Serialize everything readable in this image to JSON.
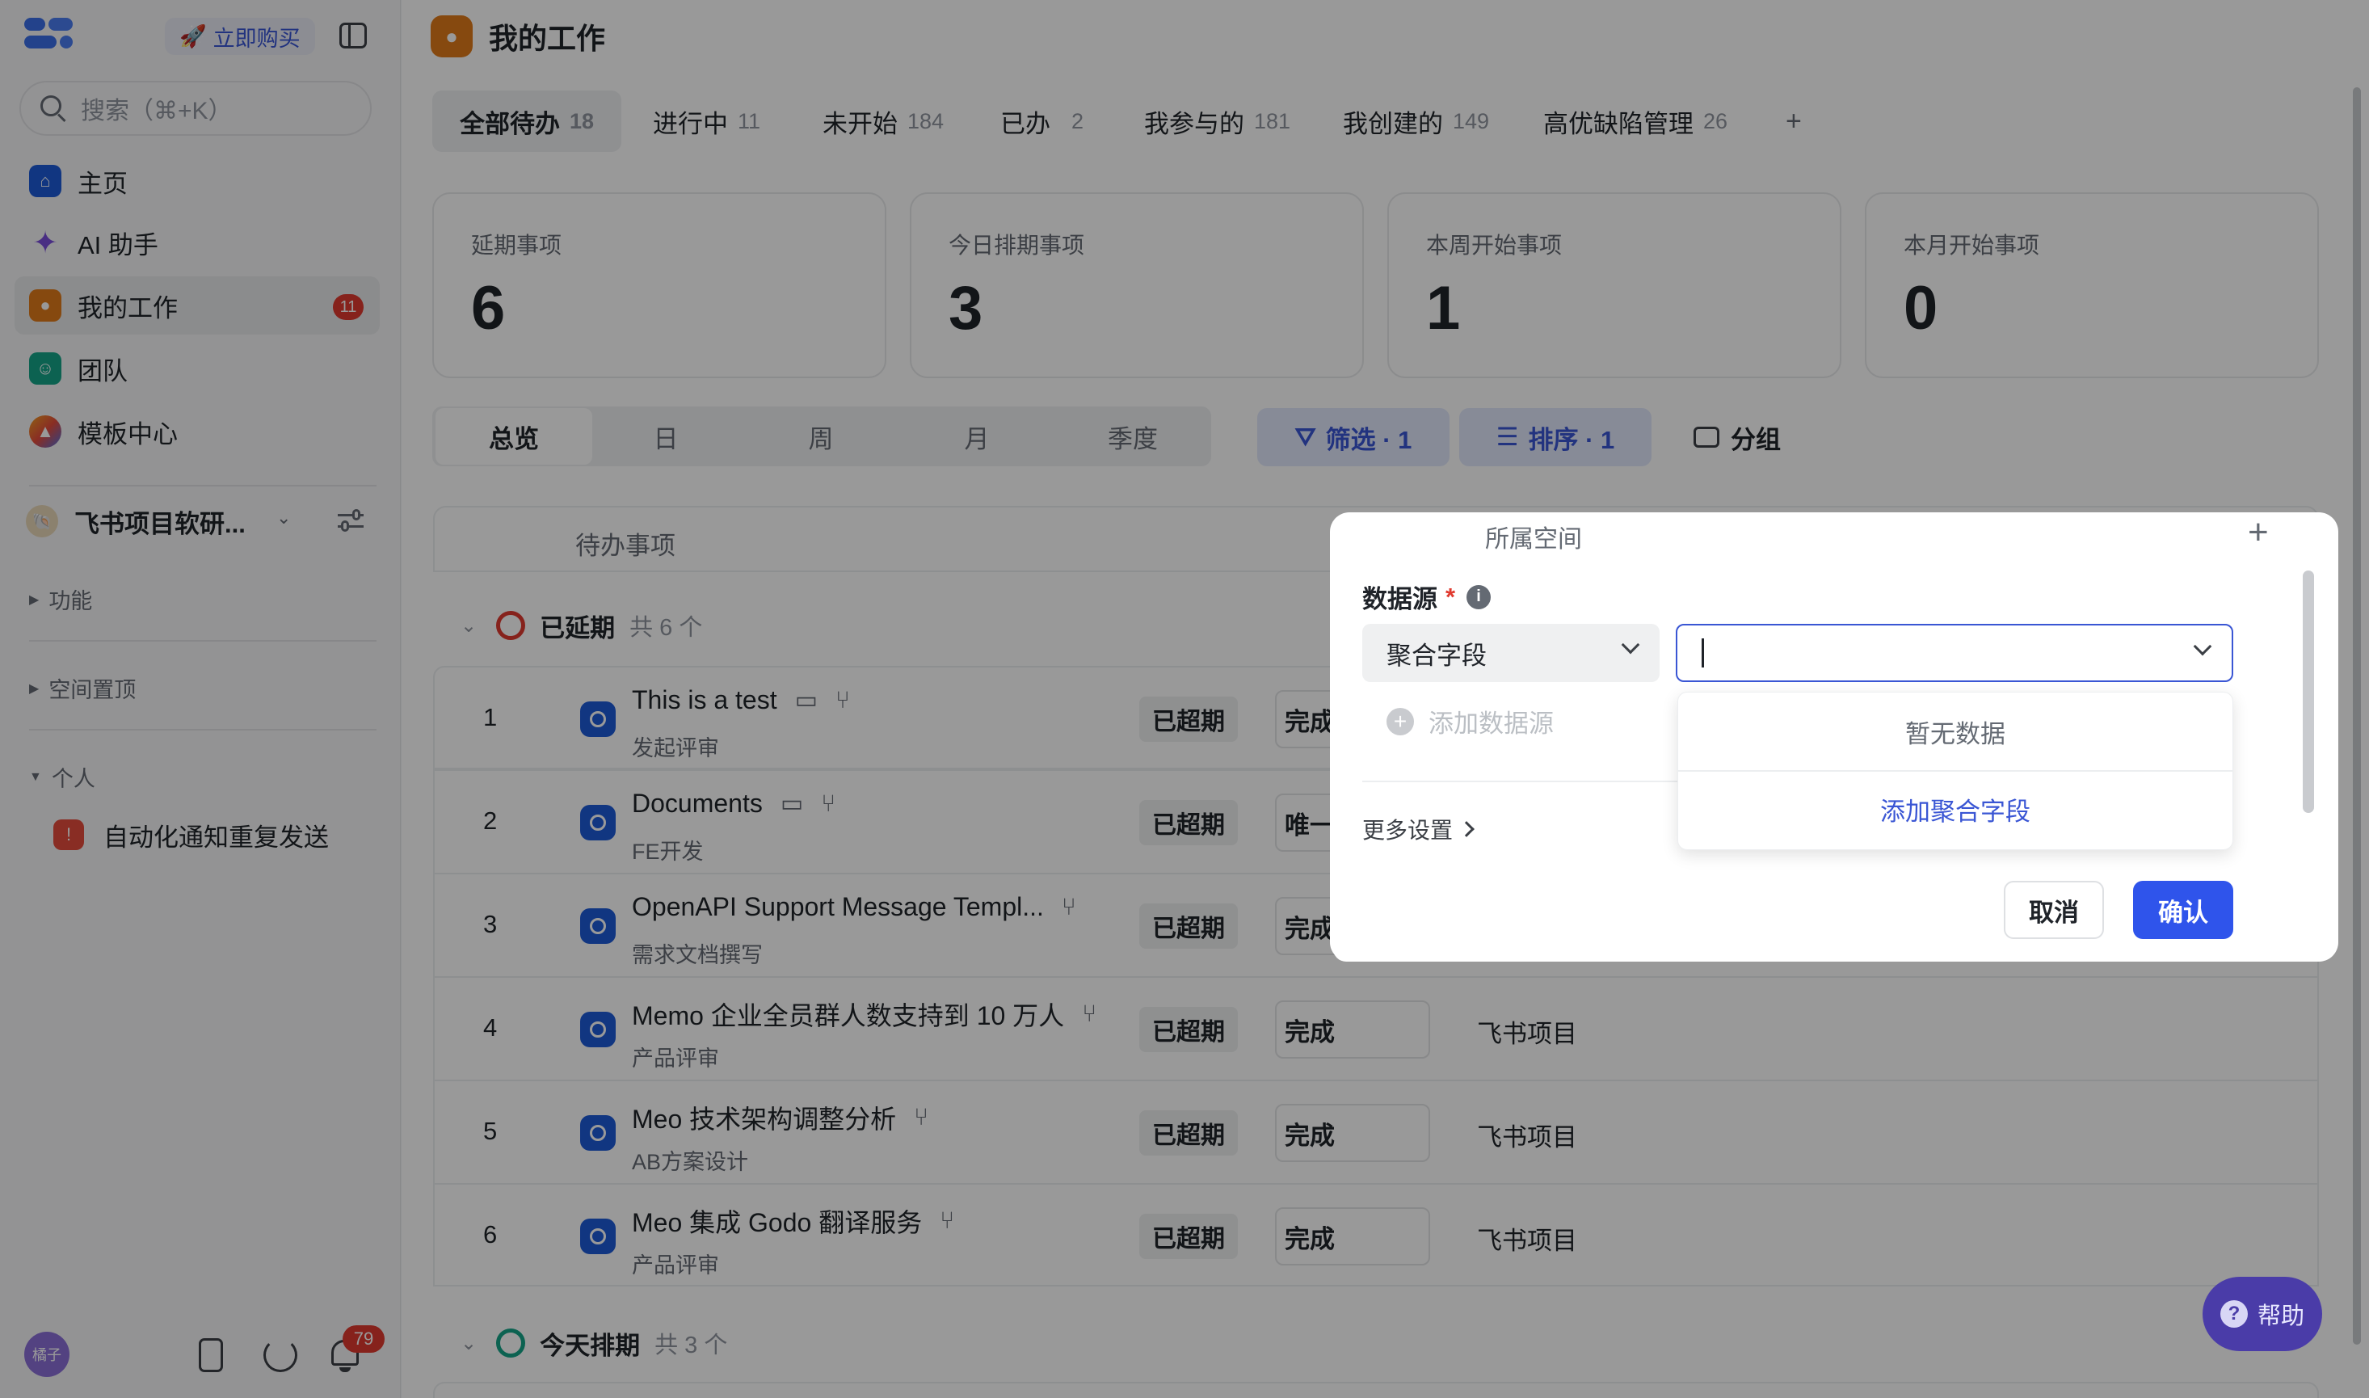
{
  "app": {
    "buy_label": "立即购买",
    "search_placeholder": "搜索（⌘+K）",
    "avatar_text": "橘子",
    "notification_count": "79"
  },
  "sidebar": {
    "items": [
      {
        "label": "主页",
        "icon": "home-icon",
        "color": "#1d5bd8"
      },
      {
        "label": "AI 助手",
        "icon": "sparkle-icon",
        "color": "#7b4ddb"
      },
      {
        "label": "我的工作",
        "icon": "person-icon",
        "color": "#e07b1a",
        "badge": "11"
      },
      {
        "label": "团队",
        "icon": "team-icon",
        "color": "#14a388"
      },
      {
        "label": "模板中心",
        "icon": "template-icon",
        "color": "#e54c3c"
      }
    ],
    "workspace_name": "飞书项目软研...",
    "sections": {
      "functions": "功能",
      "space_pinned": "空间置顶",
      "personal": "个人"
    },
    "personal_item": "自动化通知重复发送"
  },
  "page": {
    "title": "我的工作",
    "tabs": [
      {
        "label": "全部待办",
        "count": "18"
      },
      {
        "label": "进行中",
        "count": "11"
      },
      {
        "label": "未开始",
        "count": "184"
      },
      {
        "label": "已办",
        "count": "2"
      },
      {
        "label": "我参与的",
        "count": "181"
      },
      {
        "label": "我创建的",
        "count": "149"
      },
      {
        "label": "高优缺陷管理",
        "count": "26"
      }
    ],
    "add_tab": "+",
    "stats": [
      {
        "label": "延期事项",
        "value": "6"
      },
      {
        "label": "今日排期事项",
        "value": "3"
      },
      {
        "label": "本周开始事项",
        "value": "1"
      },
      {
        "label": "本月开始事项",
        "value": "0"
      }
    ],
    "segments": [
      "总览",
      "日",
      "周",
      "月",
      "季度"
    ],
    "filter_label": "筛选 · 1",
    "sort_label": "排序 · 1",
    "group_label": "分组",
    "table_header": "待办事项",
    "group_overdue": {
      "title": "已延期",
      "count": "共 6 个"
    },
    "group_today": {
      "title": "今天排期",
      "count": "共 3 个"
    },
    "rows": [
      {
        "idx": "1",
        "title": "This is a test",
        "sub": "发起评审",
        "tag": "已超期",
        "status": "完成",
        "space": ""
      },
      {
        "idx": "2",
        "title": "Documents",
        "sub": "FE开发",
        "tag": "已超期",
        "status": "唯一依",
        "space": ""
      },
      {
        "idx": "3",
        "title": "OpenAPI Support Message Templ...",
        "sub": "需求文档撰写",
        "tag": "已超期",
        "status": "完成",
        "space": ""
      },
      {
        "idx": "4",
        "title": "Memo 企业全员群人数支持到 10 万人",
        "sub": "产品评审",
        "tag": "已超期",
        "status": "完成",
        "space": "飞书项目"
      },
      {
        "idx": "5",
        "title": "Meo 技术架构调整分析",
        "sub": "AB方案设计",
        "tag": "已超期",
        "status": "完成",
        "space": "飞书项目"
      },
      {
        "idx": "6",
        "title": "Meo 集成 Godo 翻译服务",
        "sub": "产品评审",
        "tag": "已超期",
        "status": "完成",
        "space": "飞书项目"
      }
    ],
    "help_label": "帮助"
  },
  "popup": {
    "header_partial": "所属空间",
    "field_label": "数据源",
    "required_mark": "*",
    "left_select": "聚合字段",
    "right_select_value": "",
    "add_source": "添加数据源",
    "more_settings": "更多设置",
    "dropdown_empty": "暂无数据",
    "dropdown_add": "添加聚合字段",
    "cancel": "取消",
    "confirm": "确认"
  }
}
